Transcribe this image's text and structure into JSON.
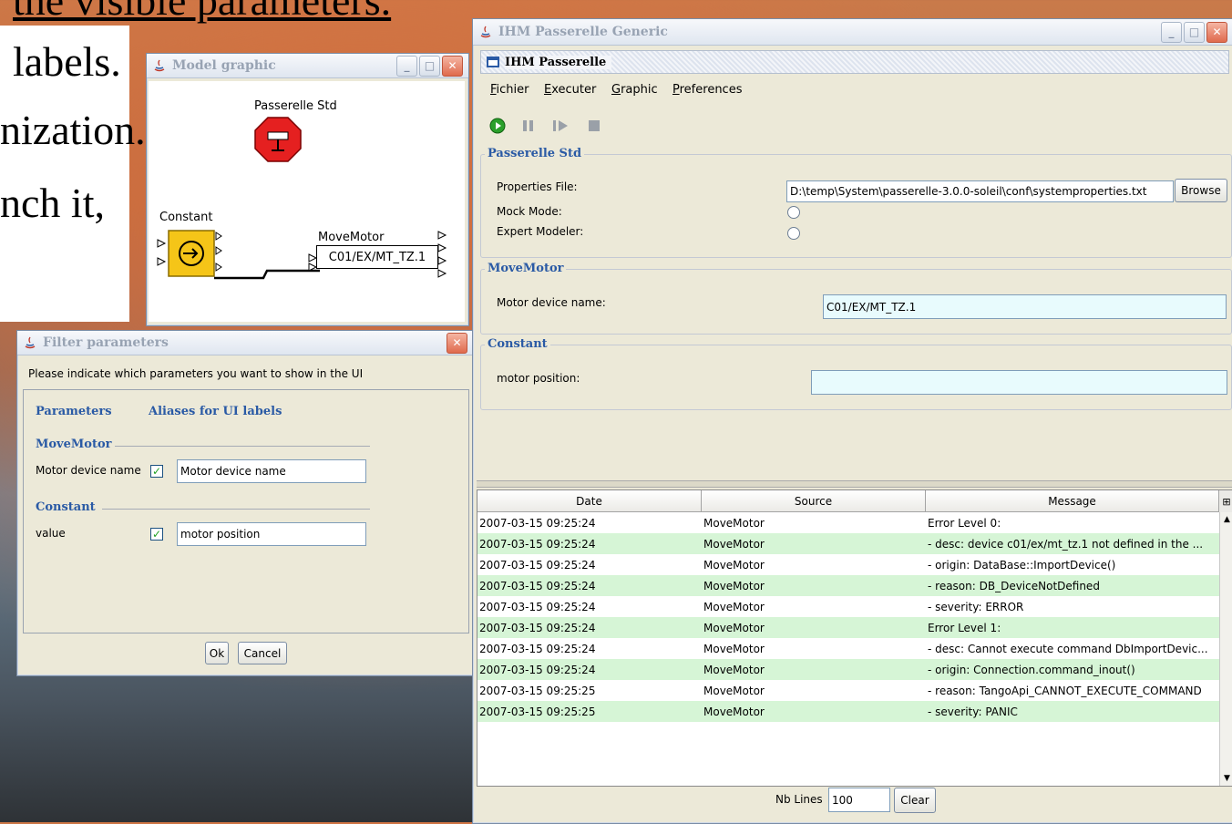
{
  "background": {
    "lines": [
      "the visible parameters.",
      "labels.",
      "nization.",
      "nch it,"
    ]
  },
  "model_graphic": {
    "title": "Model graphic",
    "actors": {
      "passerelle_std": "Passerelle Std",
      "constant": "Constant",
      "movemotor_name": "MoveMotor",
      "movemotor_param": "C01/EX/MT_TZ.1"
    }
  },
  "filter_params": {
    "title": "Filter parameters",
    "instruction": "Please indicate which parameters you want to show in the UI",
    "col_params": "Parameters",
    "col_aliases": "Aliases for UI labels",
    "sections": [
      {
        "name": "MoveMotor",
        "param": "Motor device name",
        "checked": true,
        "alias": "Motor device name"
      },
      {
        "name": "Constant",
        "param": "value",
        "checked": true,
        "alias": "motor position"
      }
    ],
    "ok": "Ok",
    "cancel": "Cancel"
  },
  "ihm": {
    "title": "IHM Passerelle Generic",
    "inner_title": "IHM Passerelle",
    "menu": [
      {
        "first": "F",
        "rest": "ichier"
      },
      {
        "first": "E",
        "rest": "xecuter"
      },
      {
        "first": "G",
        "rest": "raphic"
      },
      {
        "first": "P",
        "rest": "references"
      }
    ],
    "passerelle_std": {
      "title": "Passerelle Std",
      "properties_file_label": "Properties File:",
      "properties_file_value": "D:\\temp\\System\\passerelle-3.0.0-soleil\\conf\\systemproperties.txt",
      "browse": "Browse",
      "mock_mode_label": "Mock Mode:",
      "expert_modeler_label": "Expert Modeler:"
    },
    "movemotor": {
      "title": "MoveMotor",
      "label": "Motor device name:",
      "value": "C01/EX/MT_TZ.1"
    },
    "constant": {
      "title": "Constant",
      "label": "motor position:",
      "value": ""
    },
    "log": {
      "headers": [
        "Date",
        "Source",
        "Message"
      ],
      "rows": [
        [
          "2007-03-15 09:25:24",
          "MoveMotor",
          "Error Level 0:"
        ],
        [
          "2007-03-15 09:25:24",
          "MoveMotor",
          "- desc: device c01/ex/mt_tz.1 not defined in the ..."
        ],
        [
          "2007-03-15 09:25:24",
          "MoveMotor",
          "- origin: DataBase::ImportDevice()"
        ],
        [
          "2007-03-15 09:25:24",
          "MoveMotor",
          "- reason: DB_DeviceNotDefined"
        ],
        [
          "2007-03-15 09:25:24",
          "MoveMotor",
          "- severity: ERROR"
        ],
        [
          "2007-03-15 09:25:24",
          "MoveMotor",
          "Error Level 1:"
        ],
        [
          "2007-03-15 09:25:24",
          "MoveMotor",
          "- desc: Cannot execute command DbImportDevic..."
        ],
        [
          "2007-03-15 09:25:24",
          "MoveMotor",
          "- origin: Connection.command_inout()"
        ],
        [
          "2007-03-15 09:25:25",
          "MoveMotor",
          "- reason: TangoApi_CANNOT_EXECUTE_COMMAND"
        ],
        [
          "2007-03-15 09:25:25",
          "MoveMotor",
          "- severity: PANIC"
        ]
      ],
      "nb_lines_label": "Nb Lines",
      "nb_lines_value": "100",
      "clear": "Clear"
    }
  }
}
